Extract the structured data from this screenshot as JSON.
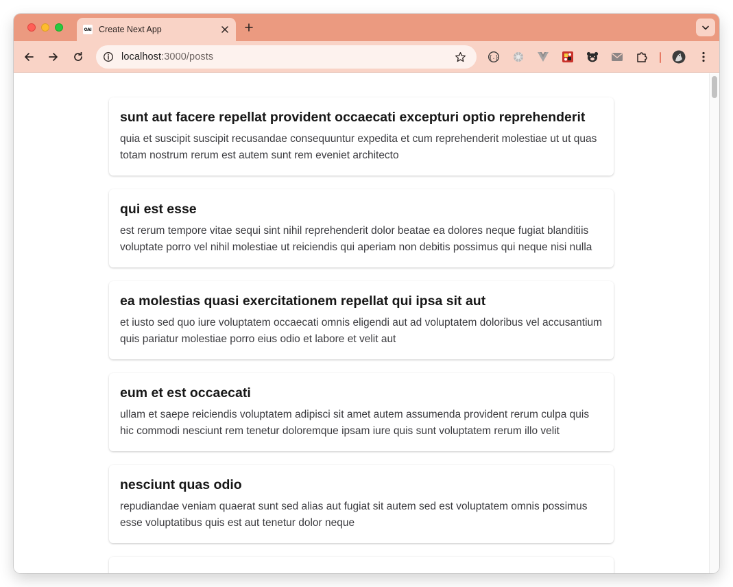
{
  "browser": {
    "tab_title": "Create Next App",
    "favicon_text": "OAI",
    "url_host": "localhost",
    "url_path": ":3000/posts",
    "colors": {
      "tabbar": "#eb9a80",
      "toolbar": "#f9d3c6",
      "omnibox": "#fdf2ee"
    },
    "extensions": [
      "json-viewer-icon",
      "wheel-extension-icon",
      "vue-devtools-icon",
      "puzzle-game-icon",
      "bear-icon",
      "mail-icon",
      "extensions-puzzle-icon"
    ]
  },
  "posts": [
    {
      "title": "sunt aut facere repellat provident occaecati excepturi optio reprehenderit",
      "body": "quia et suscipit suscipit recusandae consequuntur expedita et cum reprehenderit molestiae ut ut quas totam nostrum rerum est autem sunt rem eveniet architecto"
    },
    {
      "title": "qui est esse",
      "body": "est rerum tempore vitae sequi sint nihil reprehenderit dolor beatae ea dolores neque fugiat blanditiis voluptate porro vel nihil molestiae ut reiciendis qui aperiam non debitis possimus qui neque nisi nulla"
    },
    {
      "title": "ea molestias quasi exercitationem repellat qui ipsa sit aut",
      "body": "et iusto sed quo iure voluptatem occaecati omnis eligendi aut ad voluptatem doloribus vel accusantium quis pariatur molestiae porro eius odio et labore et velit aut"
    },
    {
      "title": "eum et est occaecati",
      "body": "ullam et saepe reiciendis voluptatem adipisci sit amet autem assumenda provident rerum culpa quis hic commodi nesciunt rem tenetur doloremque ipsam iure quis sunt voluptatem rerum illo velit"
    },
    {
      "title": "nesciunt quas odio",
      "body": "repudiandae veniam quaerat sunt sed alias aut fugiat sit autem sed est voluptatem omnis possimus esse voluptatibus quis est aut tenetur dolor neque"
    },
    {
      "title": "",
      "body": ""
    }
  ]
}
